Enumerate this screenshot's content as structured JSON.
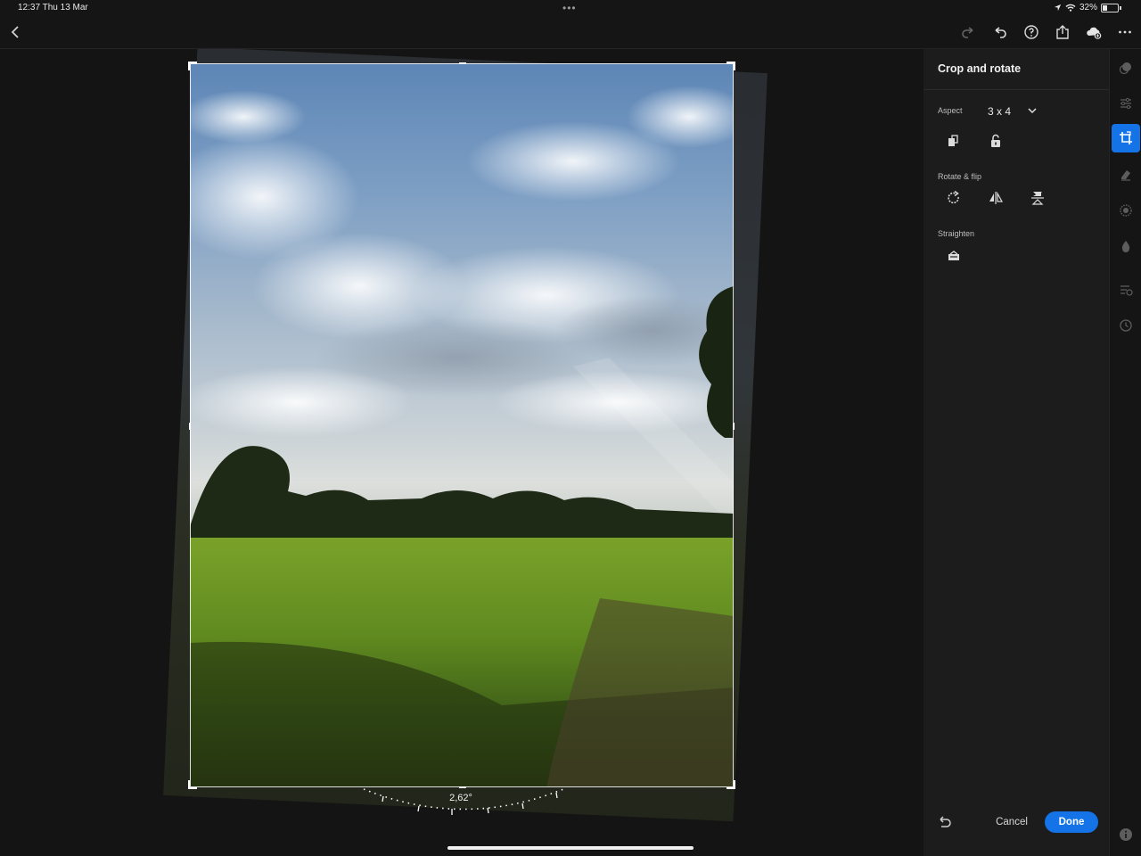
{
  "status_bar": {
    "time_date": "12:37  Thu 13 Mar",
    "multitask": "•••",
    "battery": "32%"
  },
  "topbar": {
    "icons": [
      "back-icon",
      "redo-icon",
      "undo-icon",
      "help-icon",
      "share-icon",
      "cloud-sync-icon",
      "more-icon"
    ]
  },
  "canvas": {
    "angle": "2,62°"
  },
  "panel": {
    "title": "Crop and rotate",
    "aspect_label": "Aspect",
    "aspect_value": "3 x 4",
    "rotate_flip_label": "Rotate & flip",
    "straighten_label": "Straighten",
    "cancel_label": "Cancel",
    "done_label": "Done"
  },
  "rail": {
    "icons": [
      "presets-icon",
      "adjust-icon",
      "crop-icon",
      "healing-icon",
      "masking-icon",
      "color-icon",
      "versions-icon",
      "history-icon",
      "info-icon"
    ],
    "active": "crop-icon"
  },
  "colors": {
    "accent": "#1473e6",
    "panel_bg": "#1c1c1c",
    "canvas_bg": "#141414"
  }
}
